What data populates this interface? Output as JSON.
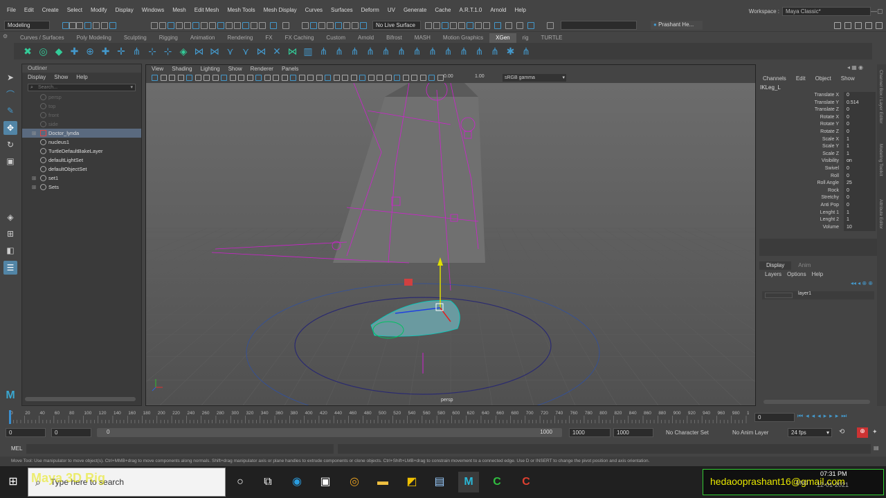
{
  "menubar": {
    "items": [
      "File",
      "Edit",
      "Create",
      "Select",
      "Modify",
      "Display",
      "Windows",
      "Mesh",
      "Edit Mesh",
      "Mesh Tools",
      "Mesh Display",
      "Curves",
      "Surfaces",
      "Deform",
      "UV",
      "Generate",
      "Cache",
      "A.R.T.1.0",
      "Arnold",
      "Help"
    ],
    "workspace_label": "Workspace :",
    "workspace_value": "Maya Classic*"
  },
  "statusline": {
    "mode": "Modeling",
    "live_surface": "No Live Surface",
    "user": "Prashant He..."
  },
  "shelf": {
    "tabs": [
      "Curves / Surfaces",
      "Poly Modeling",
      "Sculpting",
      "Rigging",
      "Animation",
      "Rendering",
      "FX",
      "FX Caching",
      "Custom",
      "Arnold",
      "Bifrost",
      "MASH",
      "Motion Graphics",
      "XGen",
      "rig",
      "TURTLE"
    ],
    "active_tab": "XGen"
  },
  "outliner": {
    "title": "Outliner",
    "menu": [
      "Display",
      "Show",
      "Help"
    ],
    "search_placeholder": "Search...",
    "items": [
      {
        "label": "persp",
        "dim": true,
        "expand": false
      },
      {
        "label": "top",
        "dim": true,
        "expand": false
      },
      {
        "label": "front",
        "dim": true,
        "expand": false
      },
      {
        "label": "side",
        "dim": true,
        "expand": false
      },
      {
        "label": "Doctor_lynda",
        "dim": false,
        "expand": true,
        "selected": true
      },
      {
        "label": "nucleus1",
        "dim": false,
        "expand": false
      },
      {
        "label": "TurtleDefaultBakeLayer",
        "dim": false,
        "expand": false
      },
      {
        "label": "defaultLightSet",
        "dim": false,
        "expand": false
      },
      {
        "label": "defaultObjectSet",
        "dim": false,
        "expand": false
      },
      {
        "label": "set1",
        "dim": false,
        "expand": true
      },
      {
        "label": "Sets",
        "dim": false,
        "expand": true
      }
    ]
  },
  "viewport": {
    "menu": [
      "View",
      "Shading",
      "Lighting",
      "Show",
      "Renderer",
      "Panels"
    ],
    "exposure": "0.00",
    "gamma": "1.00",
    "colorspace": "sRGB gamma",
    "camera_label": "persp"
  },
  "channelbox": {
    "tabs": [
      "Channels",
      "Edit",
      "Object",
      "Show"
    ],
    "node": "IKLeg_L",
    "channels": [
      {
        "name": "Translate X",
        "value": "0"
      },
      {
        "name": "Translate Y",
        "value": "0.514"
      },
      {
        "name": "Translate Z",
        "value": "0"
      },
      {
        "name": "Rotate X",
        "value": "0"
      },
      {
        "name": "Rotate Y",
        "value": "0"
      },
      {
        "name": "Rotate Z",
        "value": "0"
      },
      {
        "name": "Scale X",
        "value": "1"
      },
      {
        "name": "Scale Y",
        "value": "1"
      },
      {
        "name": "Scale Z",
        "value": "1"
      },
      {
        "name": "Visibility",
        "value": "on"
      },
      {
        "name": "Swivel",
        "value": "0"
      },
      {
        "name": "Roll",
        "value": "0"
      },
      {
        "name": "Roll Angle",
        "value": "25"
      },
      {
        "name": "Rock",
        "value": "0"
      },
      {
        "name": "Stretchy",
        "value": "0"
      },
      {
        "name": "Anti Pop",
        "value": "0"
      },
      {
        "name": "Lenght 1",
        "value": "1"
      },
      {
        "name": "Lenght 2",
        "value": "1"
      },
      {
        "name": "Volume",
        "value": "10"
      }
    ]
  },
  "layers": {
    "tabs": [
      "Display",
      "Anim"
    ],
    "menu": [
      "Layers",
      "Options",
      "Help"
    ],
    "layer_name": "layer1"
  },
  "sidetabs": [
    "Channel Box / Layer Editor",
    "Modeling Toolkit",
    "Attribute Editor"
  ],
  "timeline": {
    "ticks": [
      "0",
      "20",
      "40",
      "60",
      "80",
      "100",
      "120",
      "140",
      "160",
      "180",
      "200",
      "220",
      "240",
      "260",
      "280",
      "300",
      "320",
      "340",
      "360",
      "380",
      "400",
      "420",
      "440",
      "460",
      "480",
      "500",
      "520",
      "540",
      "560",
      "580",
      "600",
      "620",
      "640",
      "660",
      "680",
      "700",
      "720",
      "740",
      "760",
      "780",
      "800",
      "820",
      "840",
      "860",
      "880",
      "900",
      "920",
      "940",
      "960",
      "980",
      "1000"
    ],
    "current_frame": "0"
  },
  "range": {
    "start": "0",
    "anim_start": "0",
    "slider_start": "0",
    "slider_end": "1000",
    "anim_end": "1000",
    "end": "1000",
    "character_set": "No Character Set",
    "anim_layer": "No Anim Layer",
    "fps": "24 fps"
  },
  "cmdline": {
    "label": "MEL"
  },
  "helpline": "Move Tool: Use manipulator to move object(s). Ctrl+MMB+drag to move components along normals. Shift+drag manipulator axis or plane handles to extrude components or clone objects. Ctrl+Shift+LMB+drag to constrain movement to a connected edge. Use D or INSERT to change the pivot position and axis orientation.",
  "taskbar": {
    "search_placeholder": "Type here to search",
    "overlay_text": "Maya 3D Rig",
    "time": "07:31 PM",
    "date": "12-01-2021",
    "lang": "ENG",
    "email": "hedaooprashant16@gmail.com"
  },
  "colors": {
    "accent": "#5285a6",
    "rig": "#d020d0",
    "ik_handle": "#00c0c0",
    "selection": "#5a6a7f"
  }
}
